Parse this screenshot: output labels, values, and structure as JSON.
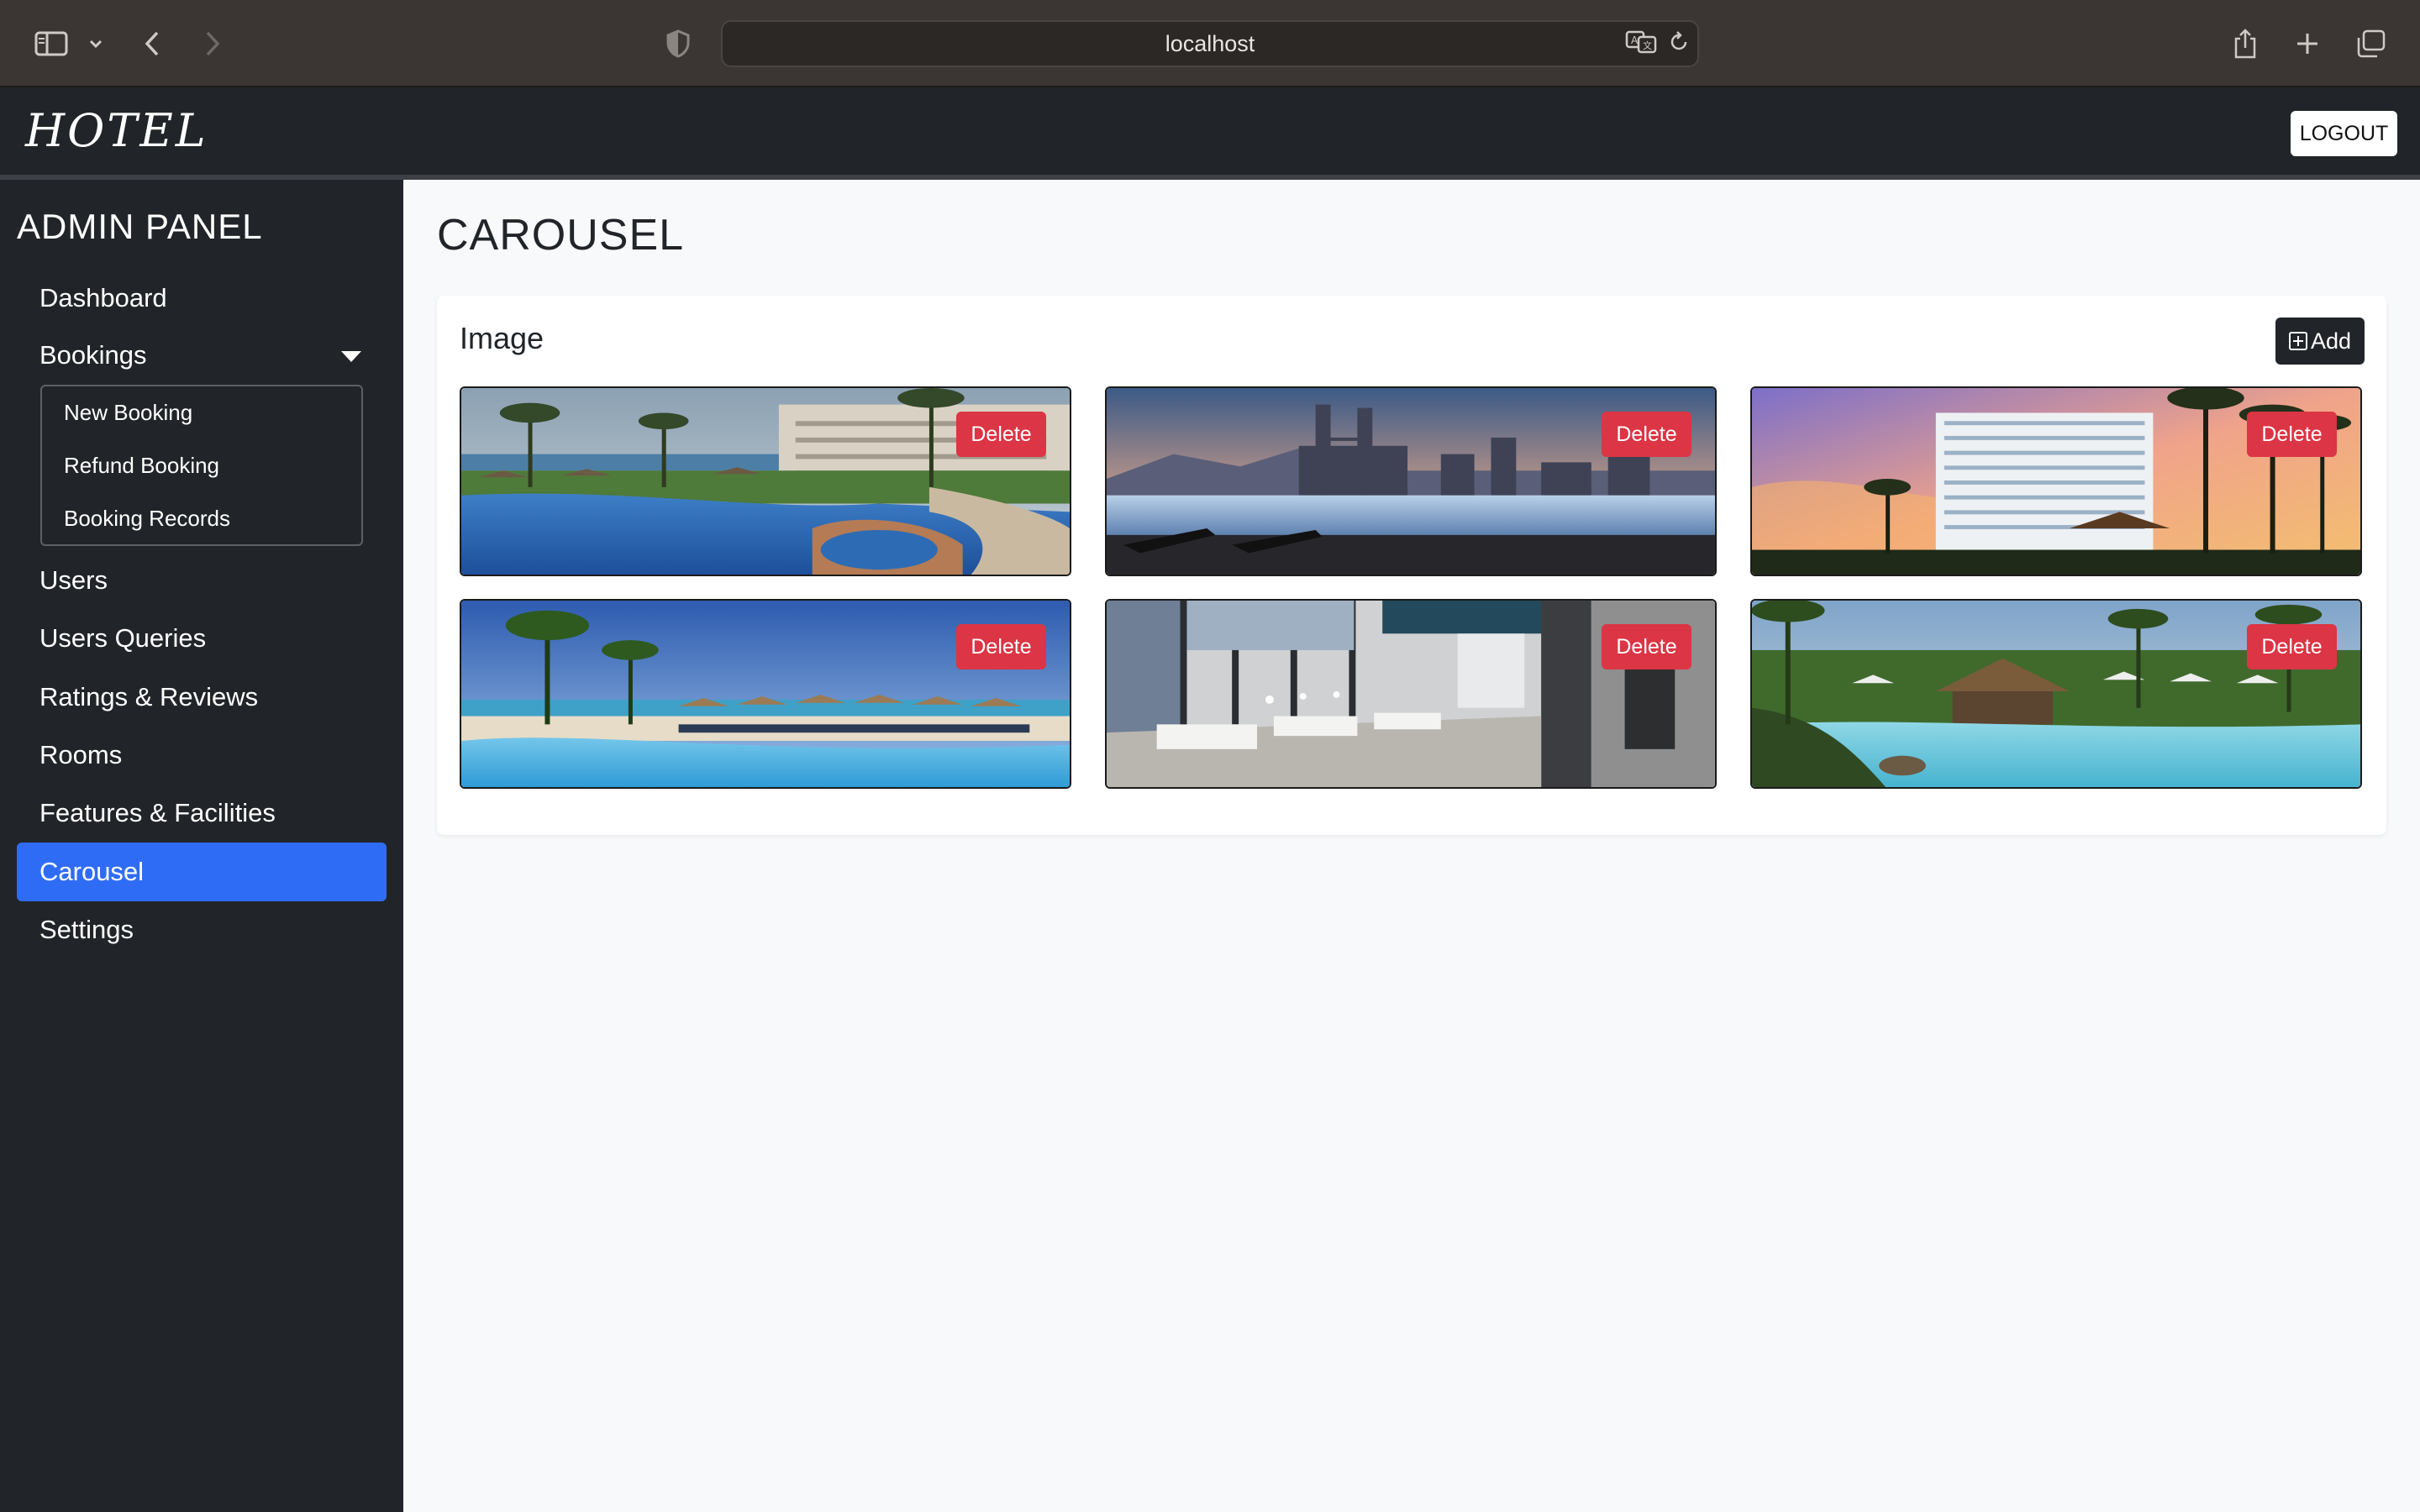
{
  "browser": {
    "url": "localhost",
    "icons": [
      "sidebar-icon",
      "chevron-down-icon",
      "back-icon",
      "forward-icon",
      "shield-icon",
      "translate-icon",
      "reload-icon",
      "share-icon",
      "new-tab-icon",
      "tabs-overview-icon"
    ]
  },
  "header": {
    "brand": "HOTEL",
    "logout_label": "LOGOUT"
  },
  "sidebar": {
    "title": "ADMIN PANEL",
    "items": [
      {
        "label": "Dashboard"
      },
      {
        "label": "Bookings",
        "expanded": true
      },
      {
        "label": "Users"
      },
      {
        "label": "Users Queries"
      },
      {
        "label": "Ratings & Reviews"
      },
      {
        "label": "Rooms"
      },
      {
        "label": "Features & Facilities"
      },
      {
        "label": "Carousel",
        "active": true
      },
      {
        "label": "Settings"
      }
    ],
    "bookings_submenu": [
      {
        "label": "New Booking"
      },
      {
        "label": "Refund Booking"
      },
      {
        "label": "Booking Records"
      }
    ]
  },
  "main": {
    "title": "CAROUSEL",
    "card": {
      "title": "Image",
      "add_label": "Add",
      "delete_label": "Delete",
      "images": [
        {
          "scene": "resort pool with palm trees and beach"
        },
        {
          "scene": "rooftop infinity pool with city skyline and twin towers"
        },
        {
          "scene": "hotel tower at sunset with palm trees"
        },
        {
          "scene": "beach pool with umbrellas and palm trees"
        },
        {
          "scene": "hotel lobby lounge interior"
        },
        {
          "scene": "tropical resort pool with thatched pavilion"
        }
      ]
    }
  },
  "colors": {
    "navbar": "#212529",
    "active": "#2f6cf6",
    "danger": "#dc3545",
    "page_bg": "#f8f9fa"
  }
}
